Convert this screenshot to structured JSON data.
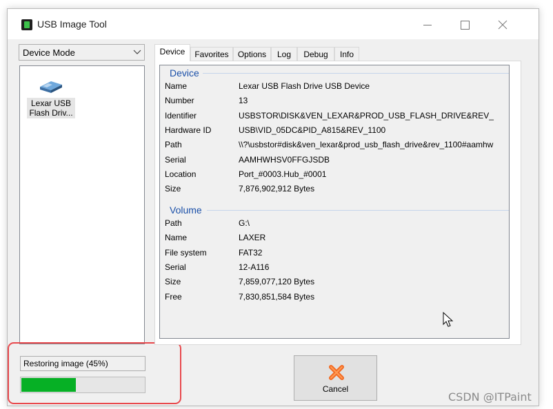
{
  "window": {
    "title": "USB Image Tool"
  },
  "sidebar": {
    "mode_value": "Device Mode",
    "devices": [
      {
        "label": "Lexar USB Flash Driv..."
      }
    ]
  },
  "status": {
    "text": "Restoring image (45%)",
    "progress": 0.45,
    "progress_color": "#06b025",
    "highlight_color": "#e8484c"
  },
  "tabs": [
    {
      "label": "Device",
      "active": true
    },
    {
      "label": "Favorites"
    },
    {
      "label": "Options"
    },
    {
      "label": "Log"
    },
    {
      "label": "Debug"
    },
    {
      "label": "Info"
    }
  ],
  "device_group": {
    "title": "Device",
    "rows": [
      {
        "key": "Name",
        "value": "Lexar USB Flash Drive USB Device"
      },
      {
        "key": "Number",
        "value": "13"
      },
      {
        "key": "Identifier",
        "value": "USBSTOR\\DISK&VEN_LEXAR&PROD_USB_FLASH_DRIVE&REV_"
      },
      {
        "key": "Hardware ID",
        "value": "USB\\VID_05DC&PID_A815&REV_1100"
      },
      {
        "key": "Path",
        "value": "\\\\?\\usbstor#disk&ven_lexar&prod_usb_flash_drive&rev_1100#aamhw"
      },
      {
        "key": "Serial",
        "value": "AAMHWHSV0FFGJSDB"
      },
      {
        "key": "Location",
        "value": "Port_#0003.Hub_#0001"
      },
      {
        "key": "Size",
        "value": "7,876,902,912 Bytes"
      }
    ]
  },
  "volume_group": {
    "title": "Volume",
    "rows": [
      {
        "key": "Path",
        "value": "G:\\"
      },
      {
        "key": "Name",
        "value": "LAXER"
      },
      {
        "key": "File system",
        "value": "FAT32"
      },
      {
        "key": "Serial",
        "value": "12-A116"
      },
      {
        "key": "Size",
        "value": "7,859,077,120 Bytes"
      },
      {
        "key": "Free",
        "value": "7,830,851,584 Bytes"
      }
    ]
  },
  "cancel_button": {
    "label": "Cancel"
  },
  "watermark": "CSDN @ITPaint"
}
